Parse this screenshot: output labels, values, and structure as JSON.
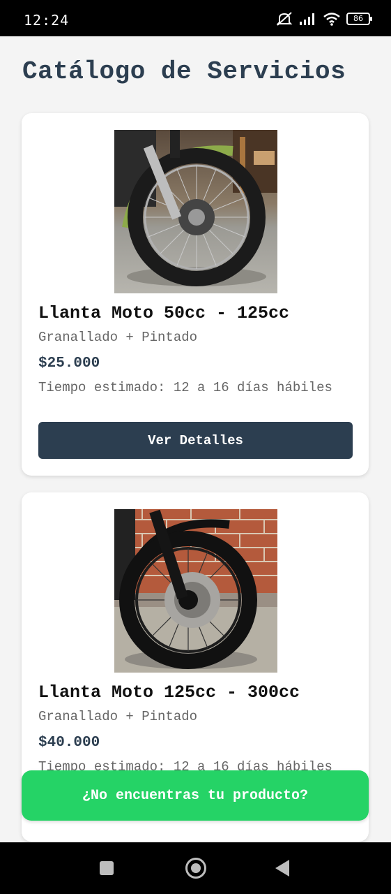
{
  "status": {
    "time": "12:24",
    "battery": "86"
  },
  "page": {
    "title": "Catálogo de Servicios"
  },
  "products": [
    {
      "title": "Llanta Moto 50cc - 125cc",
      "subtitle": "Granallado + Pintado",
      "price": "$25.000",
      "time": "Tiempo estimado: 12 a 16 días hábiles",
      "button": "Ver Detalles"
    },
    {
      "title": "Llanta Moto 125cc - 300cc",
      "subtitle": "Granallado + Pintado",
      "price": "$40.000",
      "time": "Tiempo estimado: 12 a 16 días hábiles"
    }
  ],
  "cta": {
    "label": "¿No encuentras tu producto?"
  },
  "colors": {
    "primary": "#2c3e50",
    "cta": "#25d366"
  }
}
